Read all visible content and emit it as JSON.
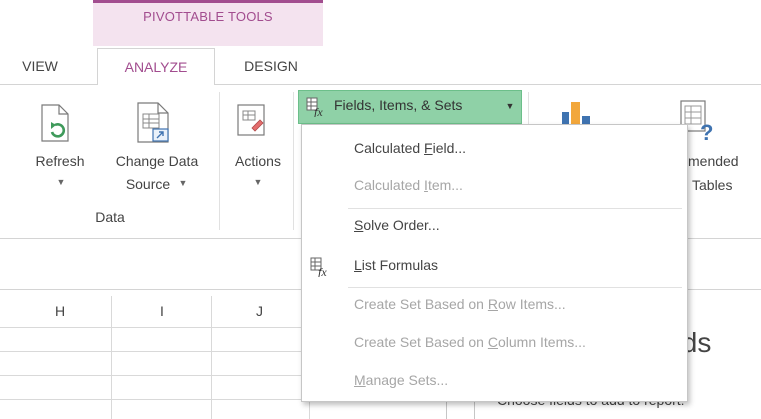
{
  "ribbon": {
    "context_group_title": "PIVOTTABLE TOOLS",
    "tabs": [
      {
        "label": "VIEW",
        "active": false
      },
      {
        "label": "ANALYZE",
        "active": true
      },
      {
        "label": "DESIGN",
        "active": false
      }
    ],
    "buttons": {
      "refresh_label": "Refresh",
      "change_data_source_line1": "Change Data",
      "change_data_source_line2": "Source",
      "actions_label": "Actions",
      "recommended_line1": "mended",
      "recommended_line2": "Tables"
    },
    "groups": {
      "data_label": "Data"
    },
    "fields_items_sets_label": "Fields, Items, & Sets",
    "colors": {
      "context_accent": "#a24d8f",
      "context_bg": "#f4e3ef",
      "highlight_green": "#8fd1a7"
    }
  },
  "menu": {
    "items": [
      {
        "before": "Calculated ",
        "underline": "F",
        "after": "ield...",
        "enabled": true,
        "icon": null
      },
      {
        "before": "Calculated ",
        "underline": "I",
        "after": "tem...",
        "enabled": false,
        "icon": null
      },
      {
        "before": "",
        "underline": "S",
        "after": "olve Order...",
        "enabled": true,
        "icon": null
      },
      {
        "before": "",
        "underline": "L",
        "after": "ist Formulas",
        "enabled": true,
        "icon": "formula-list-icon"
      },
      {
        "before": "Create Set Based on ",
        "underline": "R",
        "after": "ow Items...",
        "enabled": false,
        "icon": null
      },
      {
        "before": "Create Set Based on ",
        "underline": "C",
        "after": "olumn Items...",
        "enabled": false,
        "icon": null
      },
      {
        "before": "",
        "underline": "M",
        "after": "anage Sets...",
        "enabled": false,
        "icon": null
      }
    ]
  },
  "sheet": {
    "columns": [
      "H",
      "I",
      "J"
    ]
  },
  "field_list_pane": {
    "title_fragment": "elds",
    "subtitle": "Choose fields to add to report:"
  }
}
